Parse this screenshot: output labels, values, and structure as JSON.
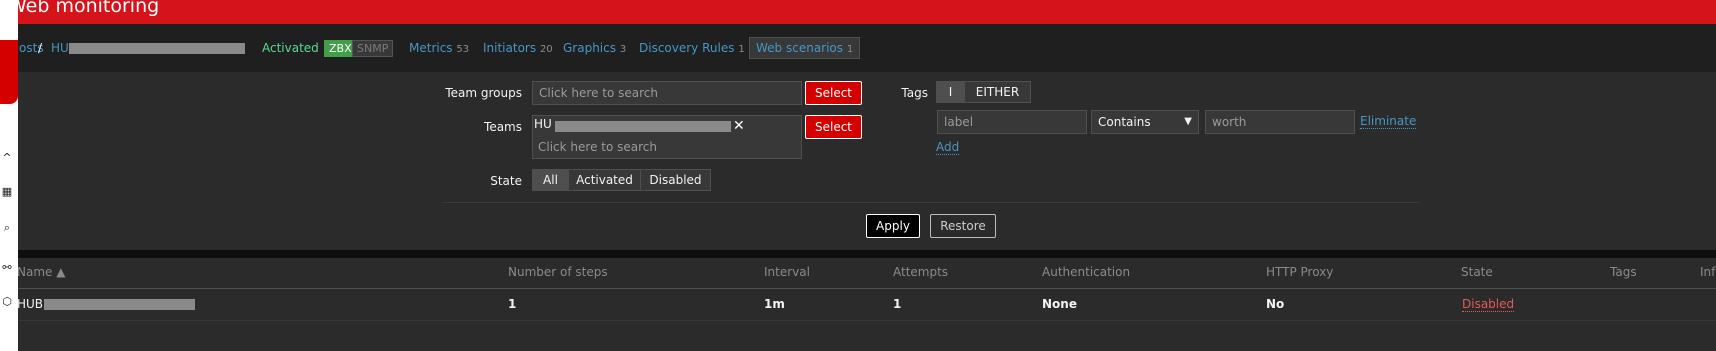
{
  "header": {
    "title": "Web monitoring"
  },
  "breadcrumb": {
    "hosts": "Hosts",
    "separator": "/",
    "host_prefix": "HU",
    "status": "Activated",
    "zbx": "ZBX",
    "snmp": "SNMP",
    "tabs": [
      {
        "label": "Metrics",
        "count": "53"
      },
      {
        "label": "Initiators",
        "count": "20"
      },
      {
        "label": "Graphics",
        "count": "3"
      },
      {
        "label": "Discovery Rules",
        "count": "1"
      },
      {
        "label": "Web scenarios",
        "count": "1"
      }
    ]
  },
  "filter": {
    "team_groups_label": "Team groups",
    "team_groups_placeholder": "Click here to search",
    "select_label": "Select",
    "teams_label": "Teams",
    "teams_chip_prefix": "HU",
    "teams_placeholder": "Click here to search",
    "state_label": "State",
    "state_options": [
      "All",
      "Activated",
      "Disabled"
    ],
    "state_selected": "All",
    "tags_label": "Tags",
    "tags_mode_options": [
      "I",
      "EITHER"
    ],
    "tags_mode_selected": "I",
    "tag_name": "label",
    "tag_operator": "Contains",
    "tag_value": "worth",
    "eliminate_label": "Eliminate",
    "add_label": "Add",
    "apply_label": "Apply",
    "restore_label": "Restore"
  },
  "table": {
    "columns": [
      "Name ▲",
      "Number of steps",
      "Interval",
      "Attempts",
      "Authentication",
      "HTTP Proxy",
      "State",
      "Tags",
      "Info"
    ],
    "rows": [
      {
        "name_prefix": "HUB",
        "steps": "1",
        "interval": "1m",
        "attempts": "1",
        "authentication": "None",
        "http_proxy": "No",
        "state": "Disabled",
        "tags": "",
        "info": ""
      }
    ]
  },
  "colors": {
    "header_red": "#d4141a",
    "link_blue": "#4796c4",
    "status_green": "#59db8f",
    "disabled_red": "#e45959",
    "zbx_green": "#429e47"
  }
}
